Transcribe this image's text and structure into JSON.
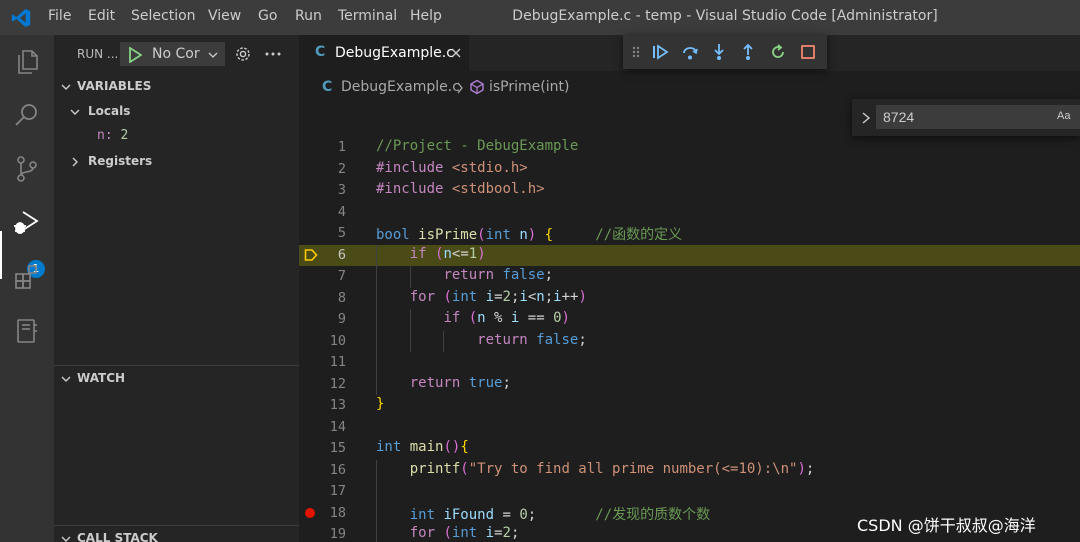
{
  "titlebar": {
    "menu": [
      "File",
      "Edit",
      "Selection",
      "View",
      "Go",
      "Run",
      "Terminal",
      "Help"
    ],
    "window_title": "DebugExample.c - temp - Visual Studio Code [Administrator]"
  },
  "activitybar": {
    "icons": [
      "explorer-icon",
      "search-icon",
      "source-control-icon",
      "run-debug-icon",
      "extensions-icon",
      "notebook-icon"
    ],
    "debug_badge": "1"
  },
  "sidebar": {
    "run_title": "RUN ...",
    "run_config": "No Cor",
    "variables_header": "VARIABLES",
    "locals_label": "Locals",
    "local_var_name": "n:",
    "local_var_value": "2",
    "registers_label": "Registers",
    "watch_header": "WATCH",
    "callstack_header": "CALL STACK"
  },
  "editor": {
    "tab_label": "DebugExample.c",
    "tab_icon": "C",
    "breadcrumb_file": "DebugExample.c",
    "breadcrumb_symbol": "isPrime(int)",
    "find_value": "8724",
    "find_case_label": "Aa",
    "current_line": 6,
    "breakpoint_lines": [
      18
    ],
    "line_numbers": [
      "1",
      "2",
      "3",
      "4",
      "5",
      "6",
      "7",
      "8",
      "9",
      "10",
      "11",
      "12",
      "13",
      "14",
      "15",
      "16",
      "17",
      "18",
      "19"
    ],
    "lines": [
      "//Project - DebugExample",
      "#include <stdio.h>",
      "#include <stdbool.h>",
      "",
      "bool isPrime(int n) {     //函数的定义",
      "    if (n<=1)",
      "        return false;",
      "    for (int i=2;i<n;i++)",
      "        if (n % i == 0)",
      "            return false;",
      "",
      "    return true;",
      "}",
      "",
      "int main(){",
      "    printf(\"Try to find all prime number(<=10):\\n\");",
      "",
      "    int iFound = 0;       //发现的质数个数",
      "    for (int i=2;"
    ]
  },
  "debug_toolbar": [
    "drag-handle-icon",
    "continue-icon",
    "step-over-icon",
    "step-into-icon",
    "step-out-icon",
    "restart-icon",
    "stop-icon"
  ],
  "colors": {
    "accent": "#007acc",
    "current_line_bg": "#4b4b18",
    "breakpoint": "#e51400",
    "current_arrow": "#ffcc00",
    "debug_green": "#89d185",
    "debug_blue": "#75beff",
    "debug_stop": "#f48771"
  },
  "watermark": "CSDN @饼干叔叔@海洋"
}
